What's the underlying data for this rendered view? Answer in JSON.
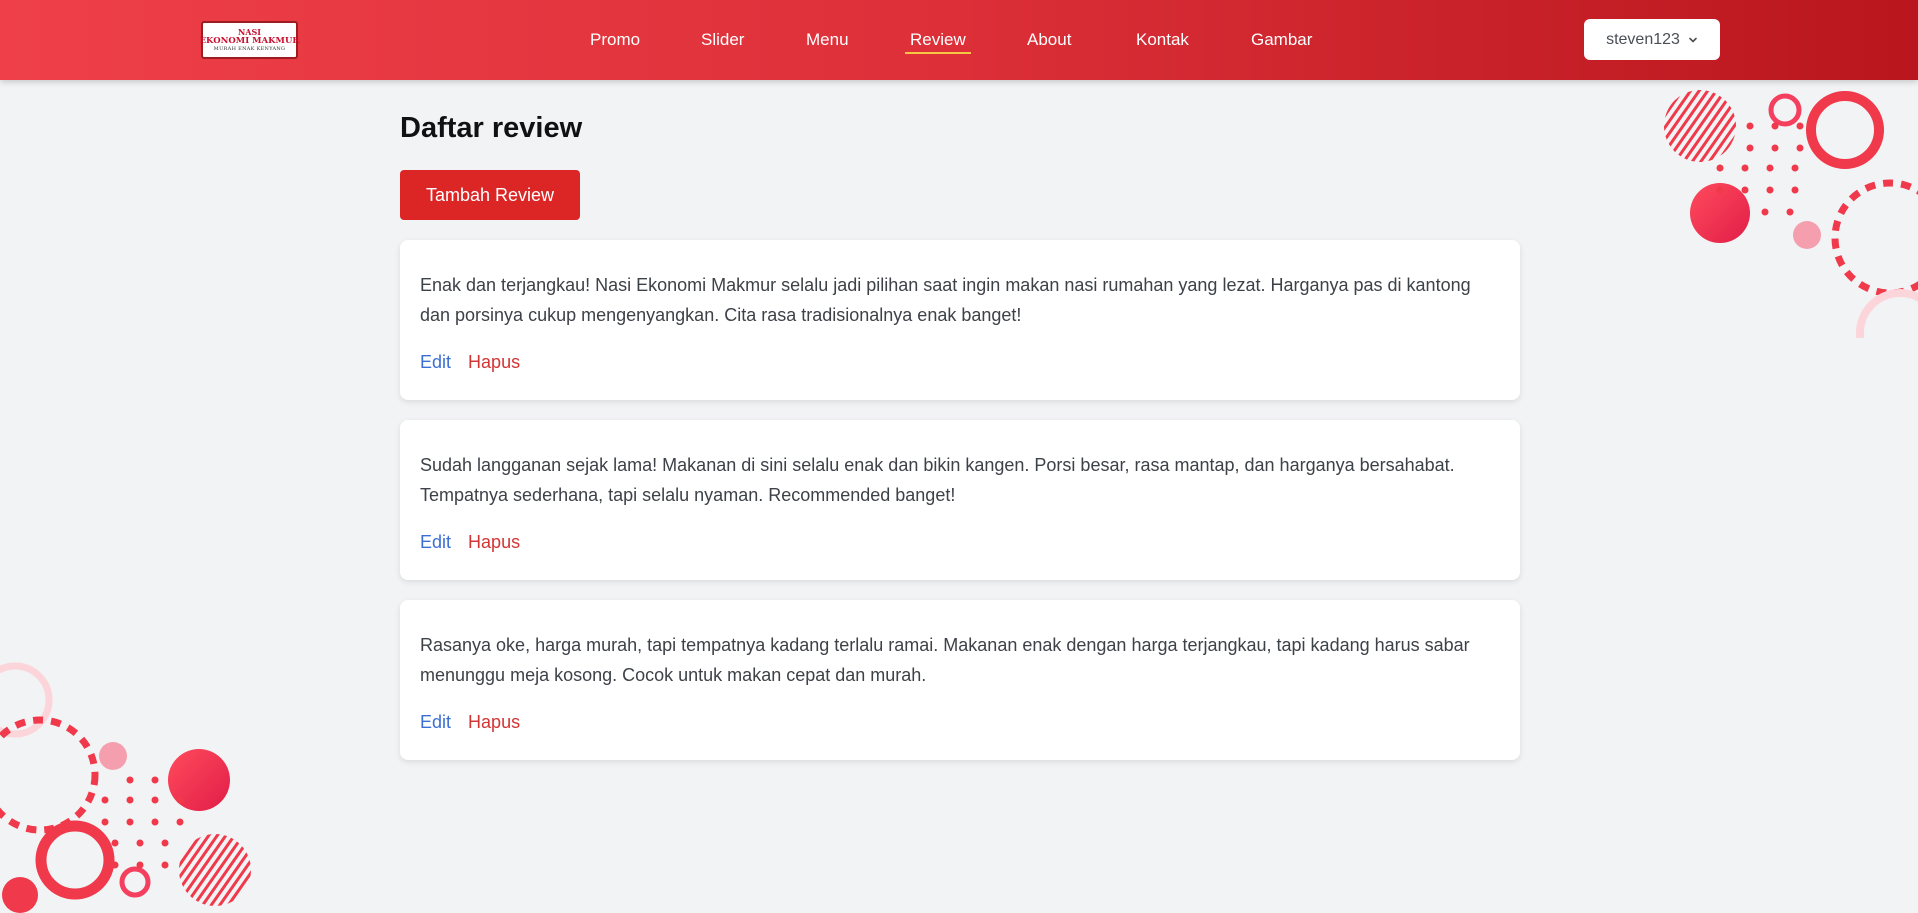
{
  "navbar": {
    "logo": {
      "line1": "NASI",
      "line2": "EKONOMI MAKMUR",
      "line3": "MURAH ENAK KENYANG"
    },
    "links": [
      {
        "label": "Promo",
        "active": false
      },
      {
        "label": "Slider",
        "active": false
      },
      {
        "label": "Menu",
        "active": false
      },
      {
        "label": "Review",
        "active": true
      },
      {
        "label": "About",
        "active": false
      },
      {
        "label": "Kontak",
        "active": false
      },
      {
        "label": "Gambar",
        "active": false
      }
    ],
    "user": {
      "name": "steven123",
      "icon": "chevron-down-icon"
    }
  },
  "main": {
    "title": "Daftar review",
    "add_button": "Tambah Review",
    "reviews": [
      {
        "text": "Enak dan terjangkau! Nasi Ekonomi Makmur selalu jadi pilihan saat ingin makan nasi rumahan yang lezat. Harganya pas di kantong dan porsinya cukup mengenyangkan. Cita rasa tradisionalnya enak banget!",
        "edit": "Edit",
        "delete": "Hapus"
      },
      {
        "text": "Sudah langganan sejak lama! Makanan di sini selalu enak dan bikin kangen. Porsi besar, rasa mantap, dan harganya bersahabat. Tempatnya sederhana, tapi selalu nyaman. Recommended banget!",
        "edit": "Edit",
        "delete": "Hapus"
      },
      {
        "text": "Rasanya oke, harga murah, tapi tempatnya kadang terlalu ramai. Makanan enak dengan harga terjangkau, tapi kadang harus sabar menunggu meja kosong. Cocok untuk makan cepat dan murah.",
        "edit": "Edit",
        "delete": "Hapus"
      }
    ]
  },
  "colors": {
    "brand_red": "#dc2626",
    "nav_gradient_start": "#ef4049",
    "nav_gradient_end": "#b9161d",
    "active_underline": "#f6c744",
    "edit_link": "#3b6fd4",
    "delete_link": "#d33434",
    "background": "#f2f3f5"
  }
}
